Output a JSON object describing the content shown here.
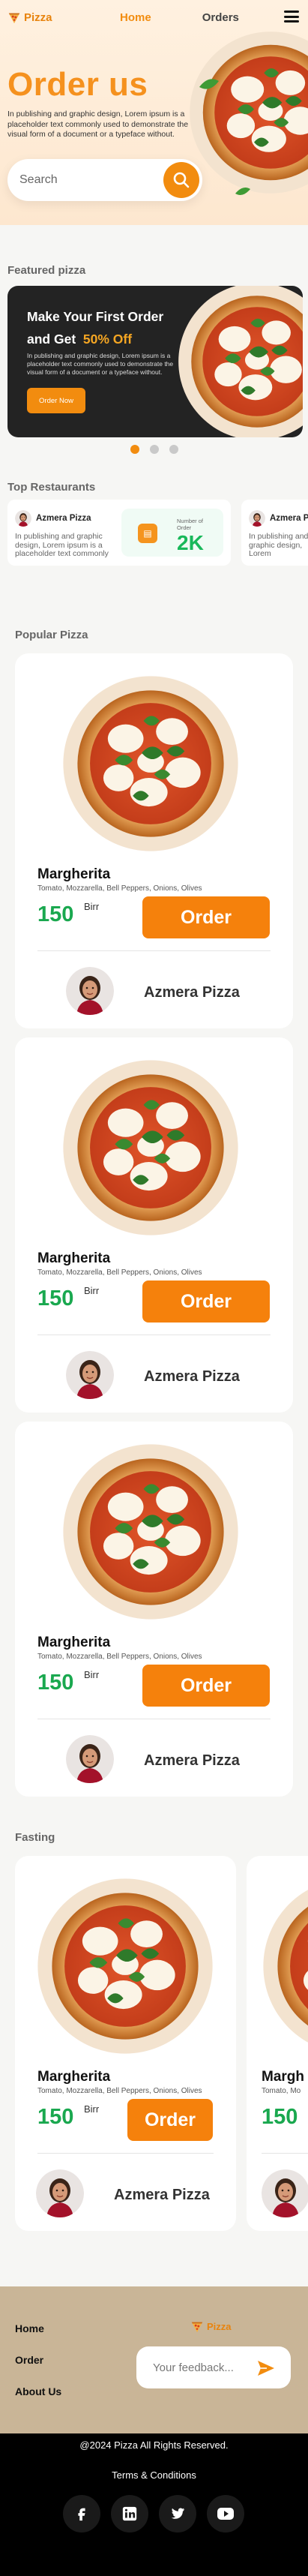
{
  "header": {
    "logo_text": "Pizza",
    "nav": {
      "home": "Home",
      "orders": "Orders"
    },
    "menu_icon": "hamburger-icon"
  },
  "hero": {
    "title": "Order us",
    "description": "In publishing and graphic design, Lorem ipsum is a placeholder text commonly used to demonstrate the visual form of a document or a typeface without.",
    "search": {
      "placeholder": "Search",
      "icon": "search-icon"
    }
  },
  "featured": {
    "section_title": "Featured pizza",
    "headline": "Make Your First Order and Get",
    "discount": "50% Off",
    "description": "In publishing and graphic design, Lorem ipsum is a placeholder text commonly used to demonstrate the visual form of a document or a typeface without.",
    "button": "Order Now",
    "dots": 3,
    "active_dot": 0
  },
  "top_restaurants": {
    "section_title": "Top Restaurants",
    "items": [
      {
        "name": "Azmera Pizza",
        "description": "In publishing and graphic design, Lorem ipsum is a placeholder text commonly",
        "badge_label": "Number of Order",
        "badge_count": "2K"
      },
      {
        "name": "Azmera Pizza",
        "description": "In publishing and graphic design, Lorem"
      }
    ]
  },
  "popular": {
    "section_title": "Popular Pizza",
    "items": [
      {
        "name": "Margherita",
        "ingredients": "Tomato, Mozzarella, Bell Peppers, Onions, Olives",
        "price": "150",
        "currency": "Birr",
        "button": "Order",
        "restaurant": "Azmera Pizza"
      },
      {
        "name": "Margherita",
        "ingredients": "Tomato, Mozzarella, Bell Peppers, Onions, Olives",
        "price": "150",
        "currency": "Birr",
        "button": "Order",
        "restaurant": "Azmera Pizza"
      },
      {
        "name": "Margherita",
        "ingredients": "Tomato, Mozzarella, Bell Peppers, Onions, Olives",
        "price": "150",
        "currency": "Birr",
        "button": "Order",
        "restaurant": "Azmera Pizza"
      }
    ]
  },
  "fasting": {
    "section_title": "Fasting",
    "items": [
      {
        "name": "Margherita",
        "ingredients": "Tomato, Mozzarella, Bell Peppers, Onions, Olives",
        "price": "150",
        "currency": "Birr",
        "button": "Order",
        "restaurant": "Azmera Pizza"
      },
      {
        "name": "Margh",
        "ingredients": "Tomato, Mo",
        "price": "150"
      }
    ]
  },
  "footer": {
    "links": [
      "Home",
      "Order",
      "About Us"
    ],
    "logo_text": "Pizza",
    "feedback_placeholder": "Your feedback...",
    "copyright": "@2024 Pizza All Rights Reserved.",
    "terms": "Terms & Conditions",
    "socials": [
      "facebook-icon",
      "linkedin-icon",
      "twitter-icon",
      "youtube-icon"
    ]
  },
  "colors": {
    "accent": "#f28c0f",
    "price_green": "#1aa84f",
    "footer_tan": "#c9b597",
    "featured_bg": "#232323"
  }
}
